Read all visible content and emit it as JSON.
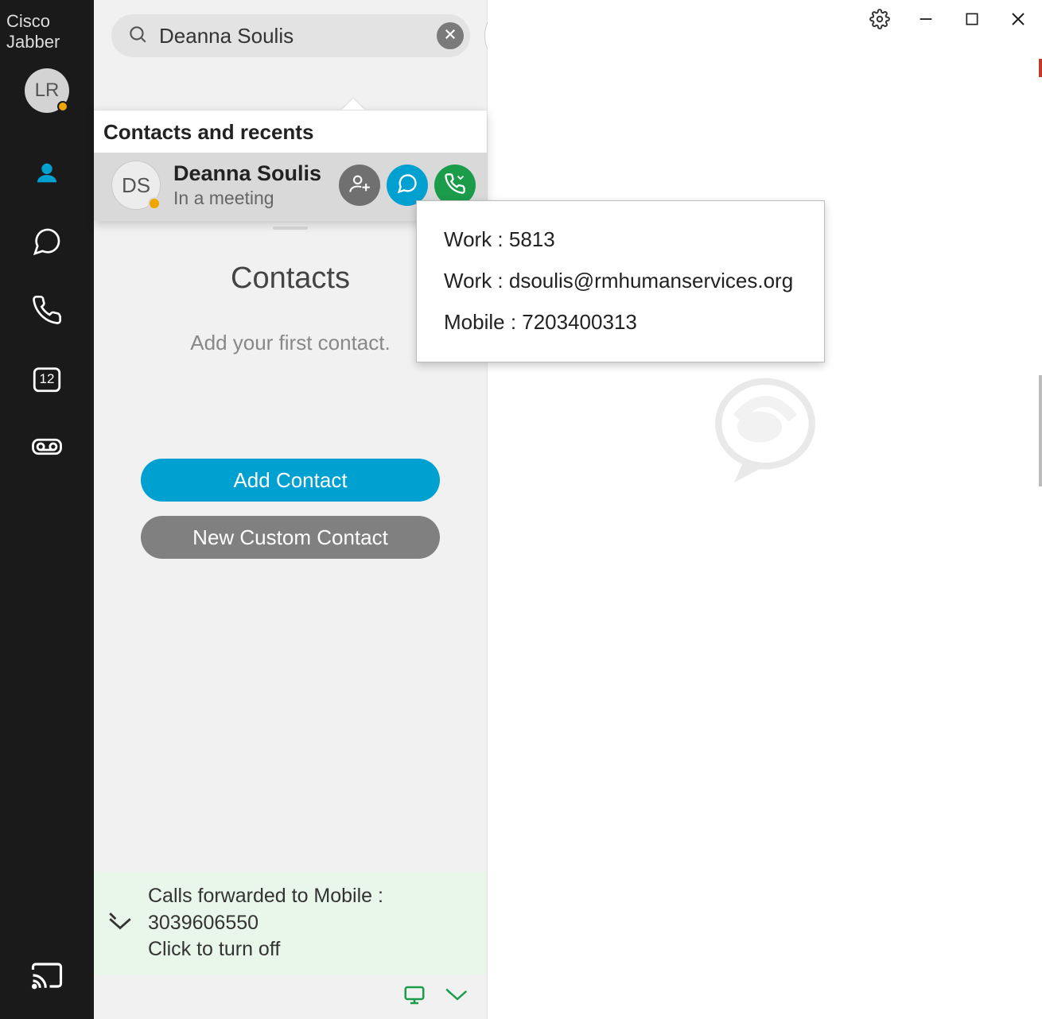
{
  "app_title": "Cisco Jabber",
  "sidebar": {
    "avatar_initials": "LR",
    "calendar_date": "12"
  },
  "search": {
    "value": "Deanna Soulis",
    "dropdown_header": "Contacts and recents",
    "result": {
      "initials": "DS",
      "name": "Deanna Soulis",
      "status": "In a meeting"
    }
  },
  "popover": {
    "lines": [
      "Work : 5813",
      "Work : dsoulis@rmhumanservices.org",
      "Mobile : 7203400313"
    ]
  },
  "contacts": {
    "title": "Contacts",
    "hint": "Add your first contact.",
    "add_button": "Add Contact",
    "custom_button": "New Custom Contact"
  },
  "forward": {
    "line1": "Calls forwarded to Mobile : 3039606550",
    "line2": "Click to turn off"
  }
}
